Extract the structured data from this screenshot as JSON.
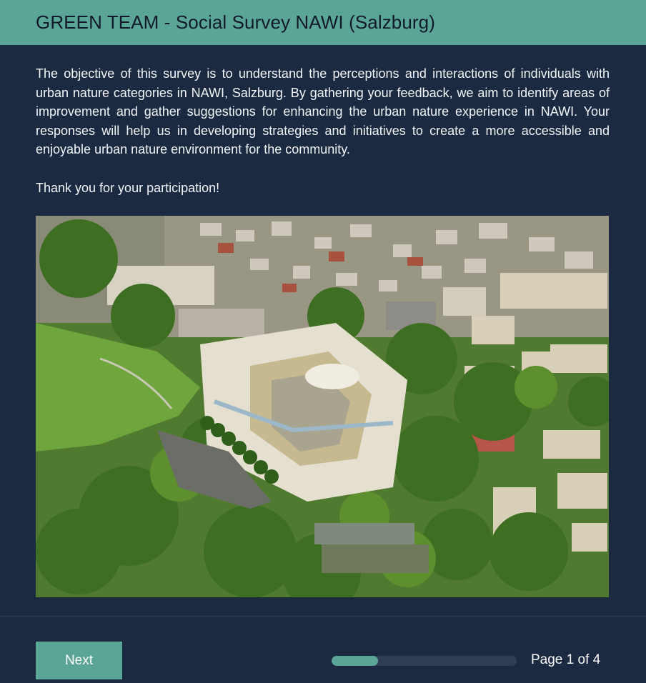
{
  "header": {
    "title": "GREEN TEAM - Social Survey NAWI (Salzburg)"
  },
  "intro": {
    "paragraph": "The objective of this survey is to understand the perceptions and interactions of individuals with urban nature categories in NAWI, Salzburg. By gathering your feedback, we aim to identify areas of improvement and gather suggestions for enhancing the urban nature experience in NAWI. Your responses will help us in developing strategies and initiatives to create a more accessible and enjoyable urban nature environment for the community.",
    "thanks": "Thank you for your participation!"
  },
  "footer": {
    "next_label": "Next",
    "page_indicator": "Page 1 of 4",
    "progress_fraction": 0.25
  },
  "colors": {
    "accent": "#5ba596",
    "background": "#1b2a41",
    "track": "#2f3e55"
  }
}
